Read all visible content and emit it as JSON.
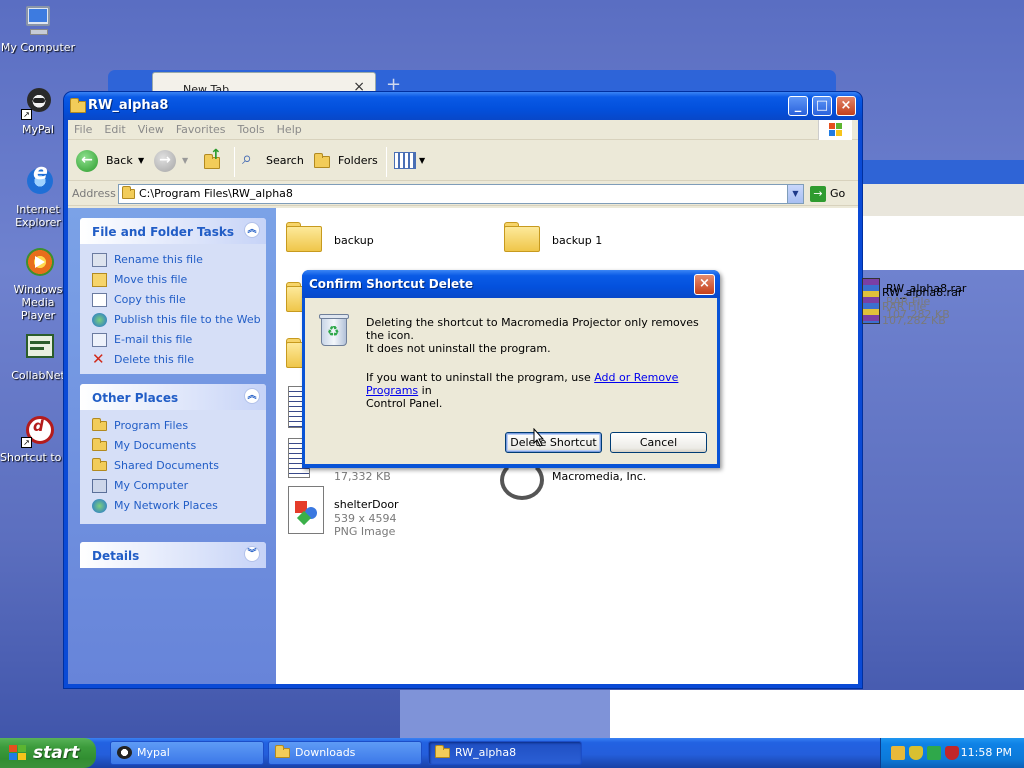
{
  "desktop": {
    "icons": [
      {
        "label": "My Computer"
      },
      {
        "label": "MyPal"
      },
      {
        "label": "Internet Explorer"
      },
      {
        "label": "Windows Media Player"
      },
      {
        "label": "CollabNet"
      },
      {
        "label": "Shortcut to ..."
      }
    ]
  },
  "background_window": {
    "tab_label": "New Tab"
  },
  "window": {
    "title": "RW_alpha8",
    "menu": [
      "File",
      "Edit",
      "View",
      "Favorites",
      "Tools",
      "Help"
    ],
    "toolbar": {
      "back": "Back",
      "search": "Search",
      "folders": "Folders"
    },
    "address": {
      "label": "Address",
      "value": "C:\\Program Files\\RW_alpha8",
      "go": "Go"
    },
    "left_pane": {
      "file_tasks": {
        "title": "File and Folder Tasks",
        "items": [
          "Rename this file",
          "Move this file",
          "Copy this file",
          "Publish this file to the Web",
          "E-mail this file",
          "Delete this file"
        ]
      },
      "other_places": {
        "title": "Other Places",
        "items": [
          "Program Files",
          "My Documents",
          "Shared Documents",
          "My Computer",
          "My Network Places"
        ]
      },
      "details": {
        "title": "Details"
      }
    },
    "files": [
      {
        "name": "backup"
      },
      {
        "name": "backup 1"
      },
      {
        "name": "RW_alpha8.rar",
        "type": "RAR File",
        "size": "107,282 KB"
      },
      {
        "name": "",
        "size": "17,332 KB"
      },
      {
        "name": "",
        "company": "Macromedia, Inc."
      },
      {
        "name": "shelterDoor",
        "dimensions": "539 x 4594",
        "type": "PNG Image"
      }
    ]
  },
  "dialog": {
    "title": "Confirm Shortcut Delete",
    "line1": "Deleting the shortcut to Macromedia Projector only removes the icon.",
    "line2": "It does not uninstall the program.",
    "line3_prefix": "If you want to uninstall the program, use ",
    "line3_link": "Add or Remove Programs",
    "line3_suffix": " in",
    "line4": "Control Panel.",
    "delete_button": "Delete Shortcut",
    "cancel_button": "Cancel"
  },
  "taskbar": {
    "start": "start",
    "tasks": [
      {
        "label": "Mypal"
      },
      {
        "label": "Downloads"
      },
      {
        "label": "RW_alpha8"
      }
    ],
    "clock": "11:58 PM"
  }
}
